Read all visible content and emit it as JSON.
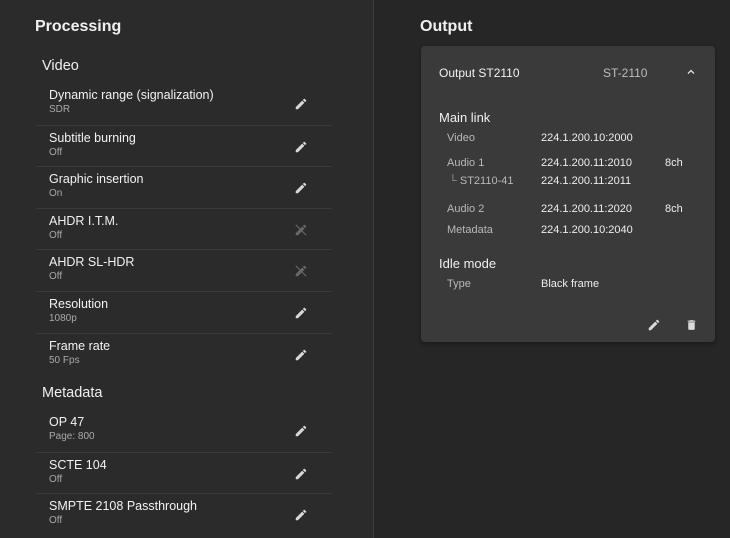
{
  "processing": {
    "title": "Processing",
    "video_heading": "Video",
    "video_items": [
      {
        "name": "Dynamic range (signalization)",
        "value": "SDR",
        "editable": true
      },
      {
        "name": "Subtitle burning",
        "value": "Off",
        "editable": true
      },
      {
        "name": "Graphic insertion",
        "value": "On",
        "editable": true
      },
      {
        "name": "AHDR I.T.M.",
        "value": "Off",
        "editable": false
      },
      {
        "name": "AHDR SL-HDR",
        "value": "Off",
        "editable": false
      },
      {
        "name": "Resolution",
        "value": "1080p",
        "editable": true
      },
      {
        "name": "Frame rate",
        "value": "50 Fps",
        "editable": true
      }
    ],
    "metadata_heading": "Metadata",
    "metadata_items": [
      {
        "name": "OP 47",
        "value": "Page: 800",
        "editable": true
      },
      {
        "name": "SCTE 104",
        "value": "Off",
        "editable": true
      },
      {
        "name": "SMPTE 2108 Passthrough",
        "value": "Off",
        "editable": true
      }
    ]
  },
  "output": {
    "title": "Output",
    "card": {
      "name": "Output ST2110",
      "type": "ST-2110",
      "main_link_heading": "Main link",
      "main_link": {
        "video_label": "Video",
        "video_value": "224.1.200.10:2000",
        "audio1_label": "Audio 1",
        "audio1_value": "224.1.200.11:2010",
        "audio1_channels": "8ch",
        "st2110_41_label": "ST2110-41",
        "st2110_41_value": "224.1.200.11:2011",
        "audio2_label": "Audio 2",
        "audio2_value": "224.1.200.11:2020",
        "audio2_channels": "8ch",
        "metadata_label": "Metadata",
        "metadata_value": "224.1.200.10:2040"
      },
      "idle_heading": "Idle mode",
      "idle": {
        "type_label": "Type",
        "type_value": "Black frame"
      }
    }
  },
  "icons": {
    "edit": "pencil-icon",
    "edit_disabled": "pencil-off-icon",
    "collapse": "chevron-up-icon",
    "delete": "trash-icon"
  },
  "colors": {
    "left_bg": "#2b2b2b",
    "right_bg": "#262626",
    "card_bg": "#3a3a3a",
    "text_primary": "#f2f2f2",
    "text_secondary": "#a9a9a9"
  }
}
